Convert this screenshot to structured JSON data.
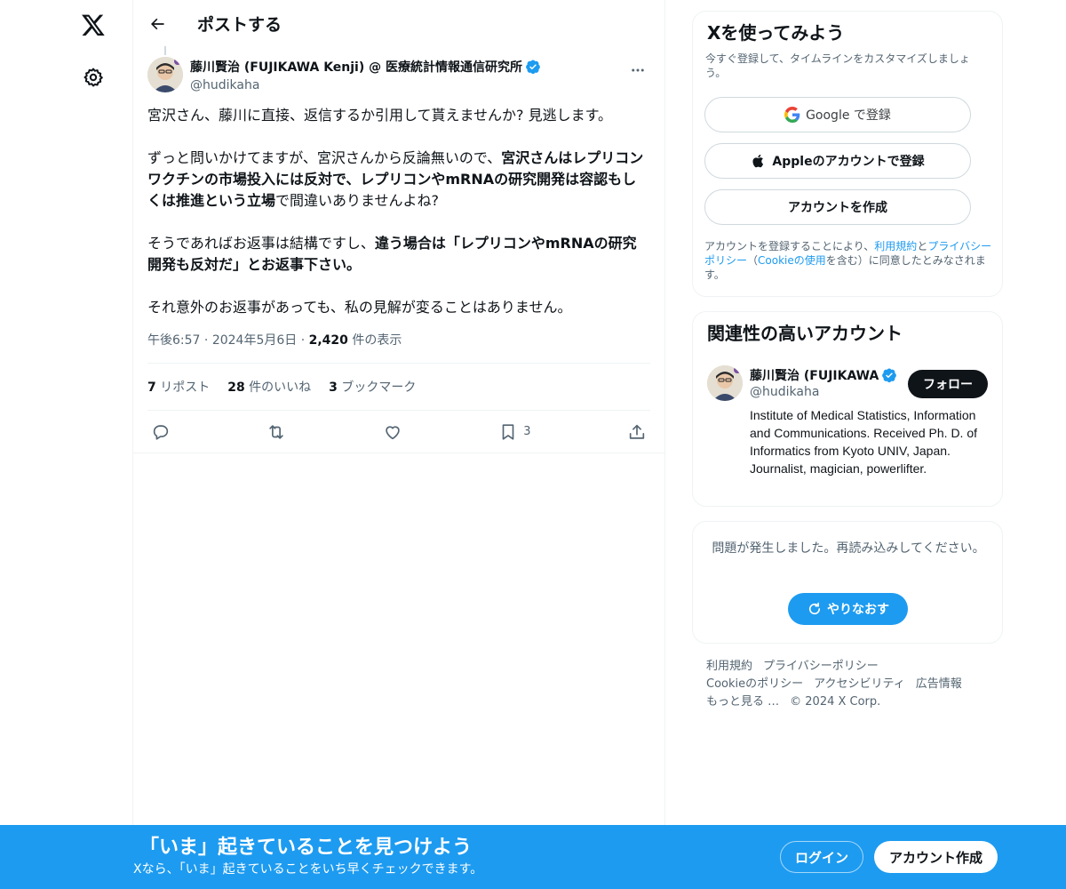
{
  "nav": {
    "logo_icon": "x-logo-icon",
    "settings_icon": "gear-icon"
  },
  "header": {
    "back_icon": "arrow-left-icon",
    "title": "ポストする"
  },
  "tweet": {
    "author_name": "藤川賢治 (FUJIKAWA Kenji) @ 医療統計情報通信研究所",
    "author_handle": "@hudikaha",
    "verified_icon": "verified-badge-icon",
    "paragraphs": [
      [
        {
          "t": "宮沢さん、藤川に直接、返信するか引用して貰えませんか? 見逃します。",
          "b": false
        }
      ],
      [
        {
          "t": "ずっと問いかけてますが、宮沢さんから反論無いので、",
          "b": false
        },
        {
          "t": "宮沢さんはレプリコンワクチンの市場投入には反対で、レプリコンやmRNAの研究開発は容認もしくは推進という立場",
          "b": true
        },
        {
          "t": "で間違いありませんよね?",
          "b": false
        }
      ],
      [
        {
          "t": "そうであればお返事は結構ですし、",
          "b": false
        },
        {
          "t": "違う場合は「レプリコンやmRNAの研究開発も反対だ」とお返事下さい。",
          "b": true
        }
      ],
      [
        {
          "t": "それ意外のお返事があっても、私の見解が変ることはありません。",
          "b": false
        }
      ]
    ],
    "time": "午後6:57",
    "date": "2024年5月6日",
    "views_count": "2,420",
    "views_label": " 件の表示",
    "sep": " · ",
    "reposts_count": "7",
    "reposts_label": " リポスト",
    "likes_count": "28",
    "likes_label": " 件のいいね",
    "bookmarks_count": "3",
    "bookmarks_label": " ブックマーク",
    "action_bookmark_count": "3"
  },
  "signup": {
    "title": "Xを使ってみよう",
    "desc": "今すぐ登録して、タイムラインをカスタマイズしましょう。",
    "google_label": "Google で登録",
    "apple_label": "Appleのアカウントで登録",
    "create_label": "アカウントを作成",
    "legal_prefix": "アカウントを登録することにより、",
    "legal_terms": "利用規約",
    "legal_and": "と",
    "legal_privacy": "プライバシーポリシー",
    "legal_open": "（",
    "legal_cookie": "Cookieの使用",
    "legal_suffix": "を含む）に同意したとみなされます。"
  },
  "related": {
    "title": "関連性の高いアカウント",
    "name": "藤川賢治 (FUJIKAWA",
    "handle": "@hudikaha",
    "follow_label": "フォロー",
    "bio": "Institute of Medical Statistics, Information and Communications. Received Ph. D. of Informatics from Kyoto UNIV, Japan. Journalist, magician, powerlifter."
  },
  "error": {
    "text": "問題が発生しました。再読み込みしてください。",
    "retry_label": "やりなおす"
  },
  "footer": {
    "links": [
      "利用規約",
      "プライバシーポリシー",
      "Cookieのポリシー",
      "アクセシビリティ",
      "広告情報",
      "もっと見る …",
      "© 2024 X Corp."
    ]
  },
  "banner": {
    "title": "「いま」起きていることを見つけよう",
    "subtitle": "Xなら、「いま」起きていることをいち早くチェックできます。",
    "login_label": "ログイン",
    "signup_label": "アカウント作成"
  },
  "colors": {
    "accent": "#1d9bf0",
    "text": "#0f1419",
    "muted": "#536471",
    "border": "#eff3f4"
  }
}
